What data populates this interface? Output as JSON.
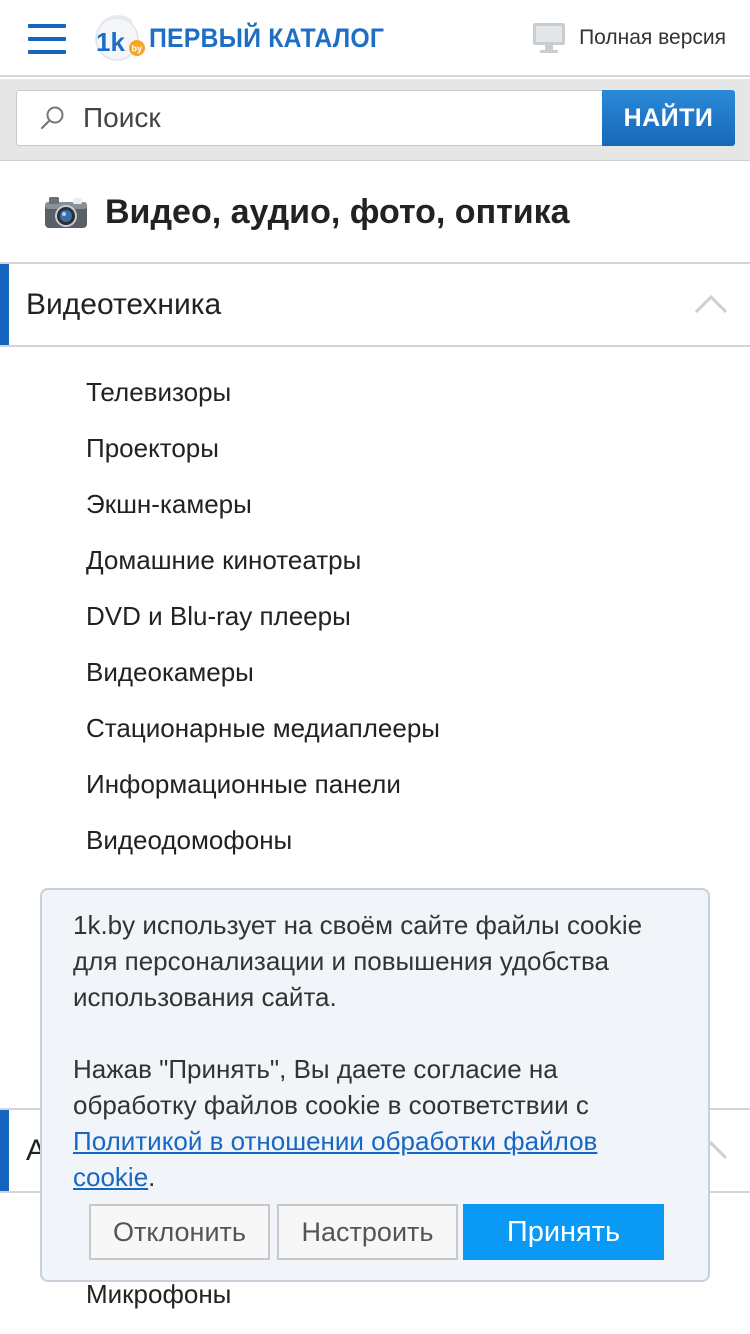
{
  "header": {
    "logo_badge": "1k",
    "logo_badge_suffix": "by",
    "logo_text": "ПЕРВЫЙ КАТАЛОГ",
    "full_version_label": "Полная версия"
  },
  "search": {
    "placeholder": "Поиск",
    "button_label": "НАЙТИ"
  },
  "category": {
    "title": "Видео, аудио, фото, оптика",
    "icon": "camera-icon"
  },
  "sections": [
    {
      "label": "Видеотехника",
      "expanded": true,
      "items": [
        "Телевизоры",
        "Проекторы",
        "Экшн-камеры",
        "Домашние кинотеатры",
        "DVD и Blu-ray плееры",
        "Видеокамеры",
        "Стационарные медиаплееры",
        "Информационные панели",
        "Видеодомофоны"
      ]
    },
    {
      "label": "А",
      "expanded": true,
      "items": [
        "Микрофоны"
      ]
    }
  ],
  "cookie": {
    "text1": "1k.by использует на своём сайте файлы cookie для персонализации и повышения удобства использования сайта.",
    "text2_prefix": "Нажав \"Принять\", Вы даете согласие на обработку файлов cookie в соответствии с ",
    "policy_link": "Политикой в отношении обработки файлов cookie",
    "text2_suffix": ".",
    "decline_label": "Отклонить",
    "setup_label": "Настроить",
    "accept_label": "Принять"
  },
  "colors": {
    "brand_blue": "#1565c0",
    "accept_blue": "#0a9af5",
    "search_button": "#1e78c8"
  }
}
